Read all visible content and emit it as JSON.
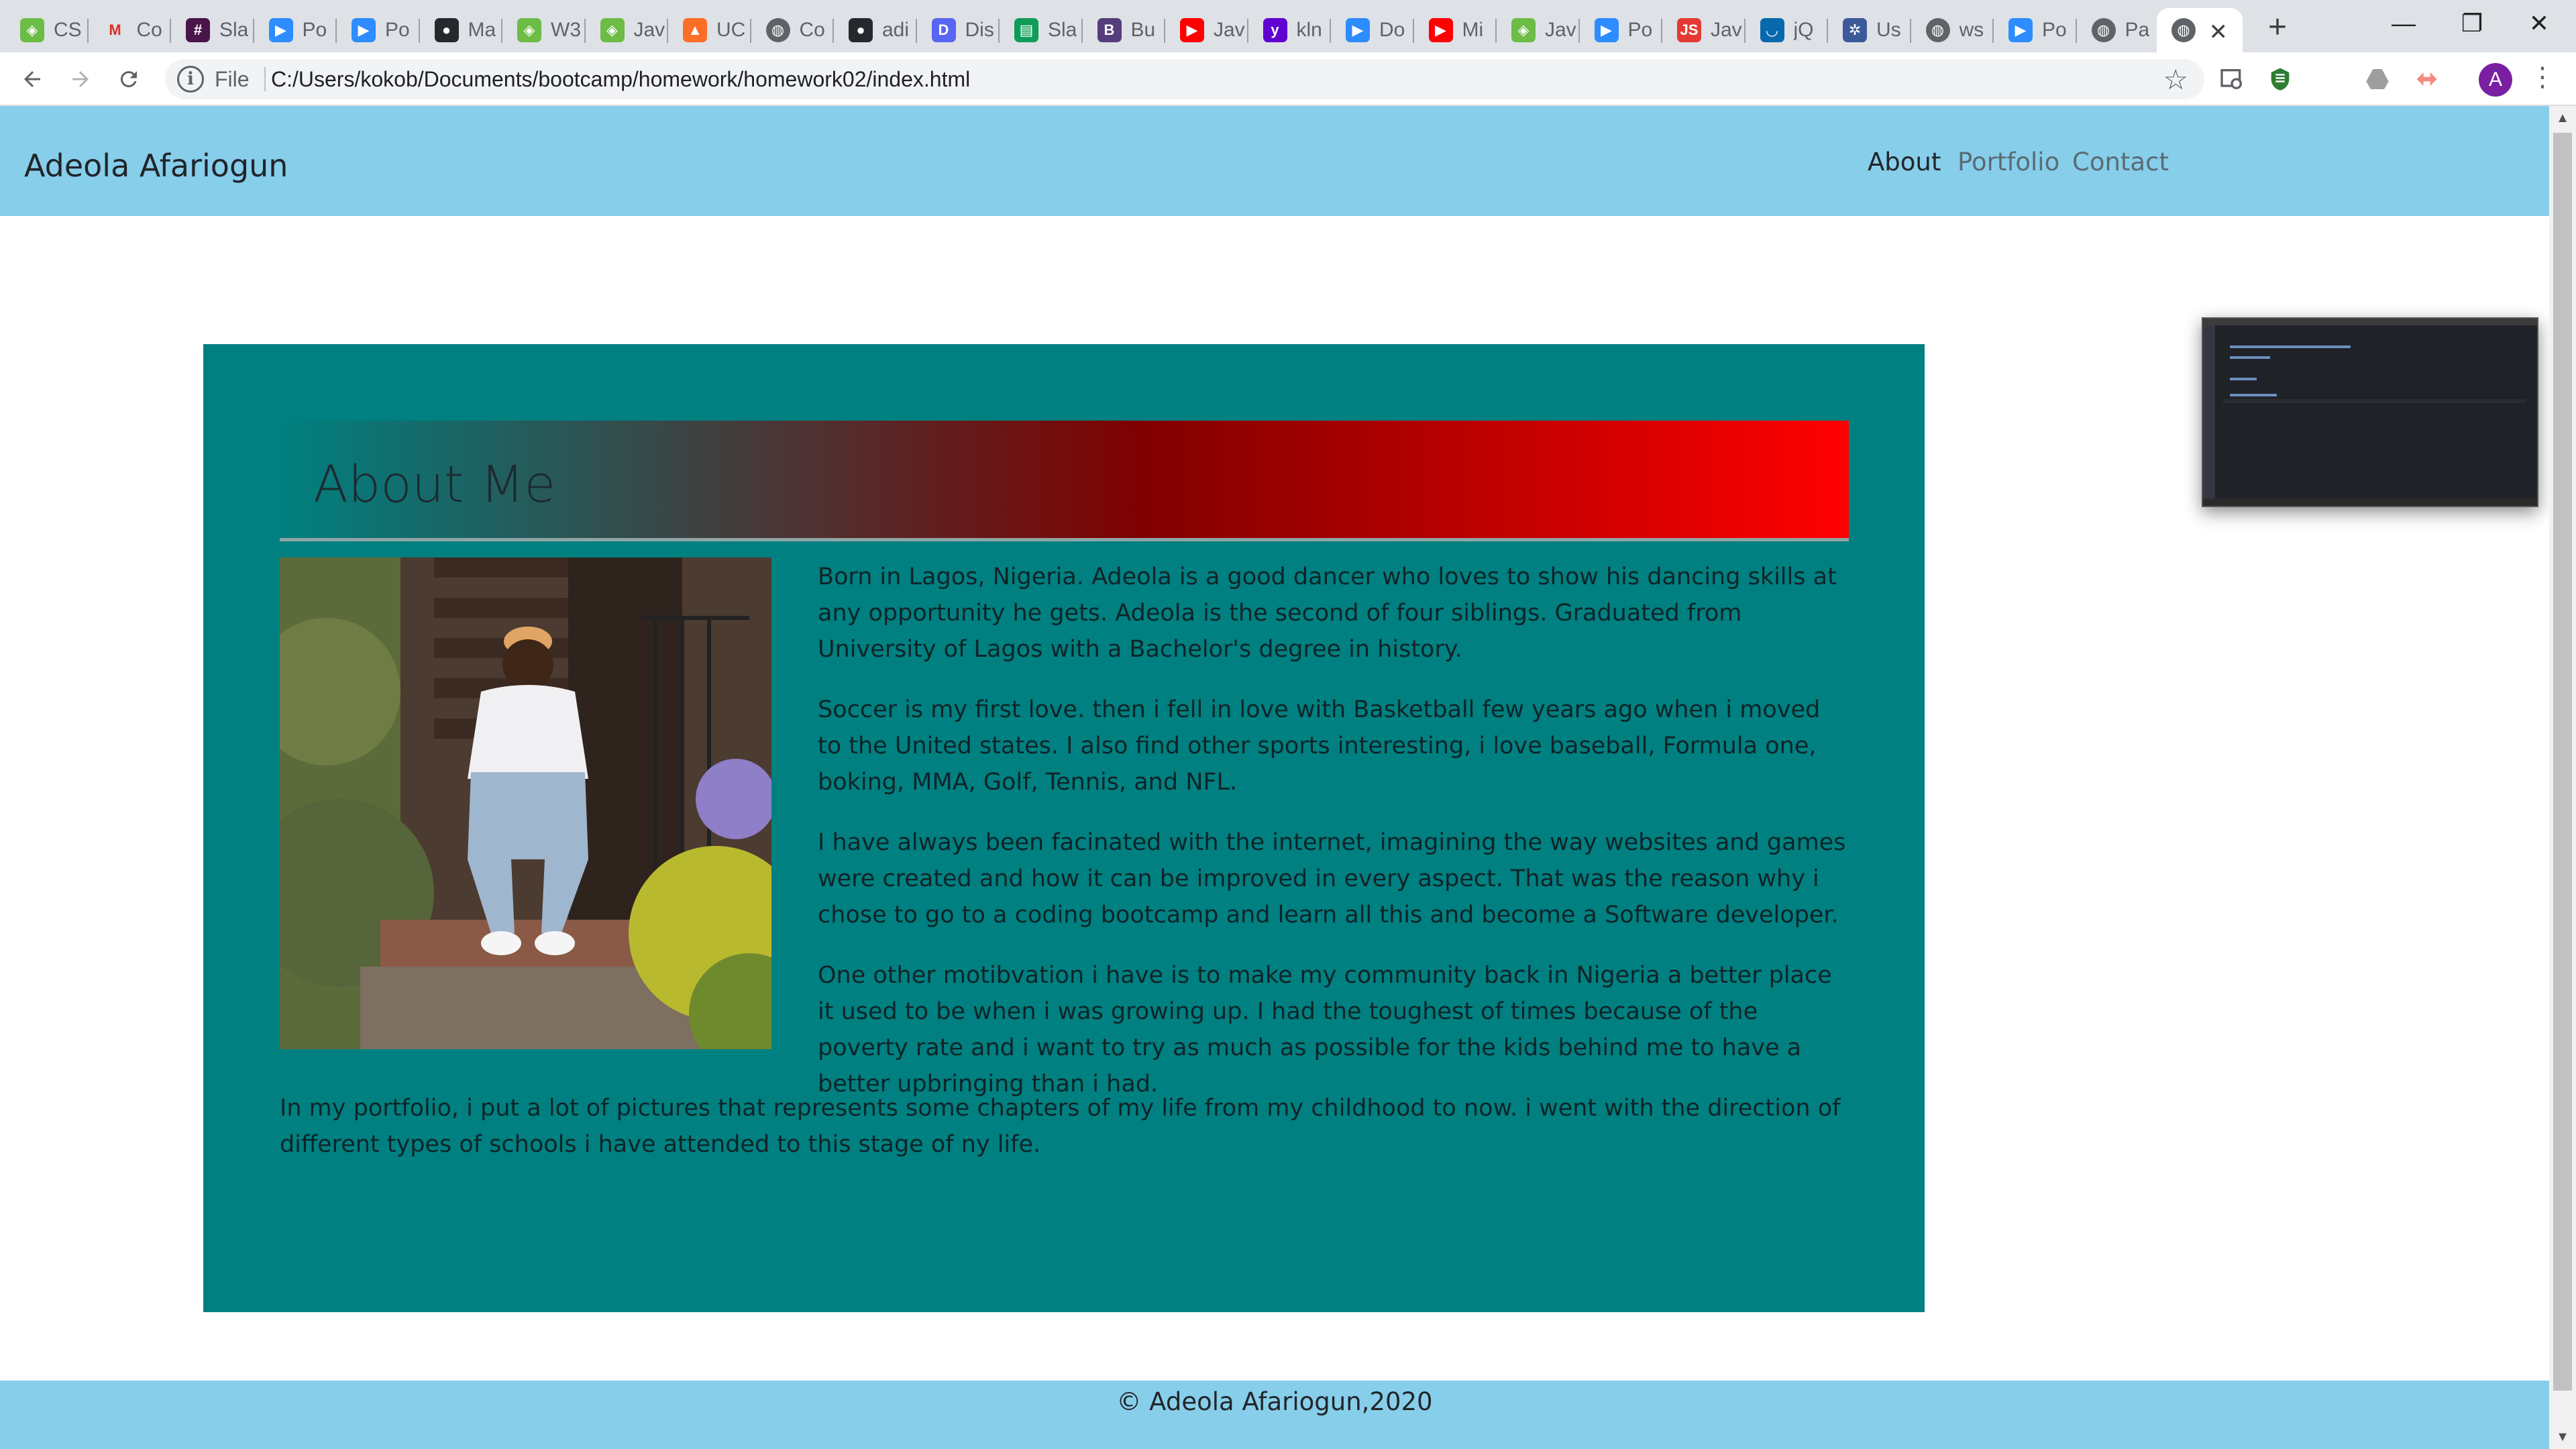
{
  "browser": {
    "tabs": [
      {
        "label": "CS",
        "icon": "repl-icon",
        "color": "#6cbc45"
      },
      {
        "label": "Co",
        "icon": "gmail-icon",
        "color": "#ffffff"
      },
      {
        "label": "Sla",
        "icon": "slack-icon",
        "color": "#4a154b"
      },
      {
        "label": "Po",
        "icon": "zoom-icon",
        "color": "#2d8cff"
      },
      {
        "label": "Po",
        "icon": "zoom-icon",
        "color": "#2d8cff"
      },
      {
        "label": "Ma",
        "icon": "github-icon",
        "color": "#24292e"
      },
      {
        "label": "W3",
        "icon": "repl-icon",
        "color": "#6cbc45"
      },
      {
        "label": "Jav",
        "icon": "repl-icon",
        "color": "#6cbc45"
      },
      {
        "label": "UC",
        "icon": "gitlab-icon",
        "color": "#fc6d26"
      },
      {
        "label": "Co",
        "icon": "globe-icon",
        "color": "#5f6368"
      },
      {
        "label": "adi",
        "icon": "github-icon",
        "color": "#24292e"
      },
      {
        "label": "Dis",
        "icon": "discord-icon",
        "color": "#5865f2"
      },
      {
        "label": "Sla",
        "icon": "sheets-icon",
        "color": "#0f9d58"
      },
      {
        "label": "Bu",
        "icon": "bootstrap-icon",
        "color": "#563d7c"
      },
      {
        "label": "Jav",
        "icon": "youtube-icon",
        "color": "#ff0000"
      },
      {
        "label": "kln",
        "icon": "yahoo-icon",
        "color": "#6001d2"
      },
      {
        "label": "Do",
        "icon": "zoom-icon",
        "color": "#2d8cff"
      },
      {
        "label": "Mi",
        "icon": "youtube-icon",
        "color": "#ff0000"
      },
      {
        "label": "Jav",
        "icon": "repl-icon",
        "color": "#6cbc45"
      },
      {
        "label": "Po",
        "icon": "zoom-icon",
        "color": "#2d8cff"
      },
      {
        "label": "Jav",
        "icon": "javascript-icon",
        "color": "#e53935"
      },
      {
        "label": "jQ",
        "icon": "jquery-icon",
        "color": "#0769ad"
      },
      {
        "label": "Us",
        "icon": "settings-icon",
        "color": "#3c5a99"
      },
      {
        "label": "ws",
        "icon": "globe-icon",
        "color": "#5f6368"
      },
      {
        "label": "Po",
        "icon": "zoom-icon",
        "color": "#2d8cff"
      },
      {
        "label": "Pa",
        "icon": "globe-icon",
        "color": "#5f6368"
      }
    ],
    "active_tab_icon": "globe-icon",
    "new_tab": "+",
    "window_controls": {
      "minimize": "—",
      "restore": "❐",
      "close": "✕"
    },
    "address": {
      "scheme_label": "File",
      "url": "C:/Users/kokob/Documents/bootcamp/homework/homework02/index.html"
    },
    "profile_initial": "A"
  },
  "site": {
    "brand": "Adeola Afariogun",
    "nav": [
      {
        "label": "About",
        "active": true
      },
      {
        "label": "Portfolio",
        "active": false
      },
      {
        "label": "Contact",
        "active": false
      }
    ],
    "about_title": "About Me",
    "paragraphs": [
      "Born in Lagos, Nigeria. Adeola is a good dancer who loves to show his dancing skills at any opportunity he gets. Adeola is the second of four siblings. Graduated from University of Lagos with a Bachelor's degree in history.",
      "Soccer is my first love. then i fell in love with Basketball few years ago when i moved to the United states. I also find other sports interesting, i love baseball, Formula one, boking, MMA, Golf, Tennis, and NFL.",
      "I have always been facinated with the internet, imagining the way websites and games were created and how it can be improved in every aspect. That was the reason why i chose to go to a coding bootcamp and learn all this and become a Software developer.",
      "One other motibvation i have is to make my community back in Nigeria a better place it used to be when i was growing up. I had the toughest of times because of the poverty rate and i want to try as much as possible for the kids behind me to have a better upbringing than i had.",
      "In my portfolio, i put a lot of pictures that represents some chapters of my life from my childhood to now. i went with the direction of different types of schools i have attended to this stage of ny life."
    ],
    "footer": "© Adeola Afariogun,2020",
    "colors": {
      "header_bg": "#87ceeb",
      "content_bg": "#008080",
      "gradient_end": "#ff0000"
    }
  }
}
